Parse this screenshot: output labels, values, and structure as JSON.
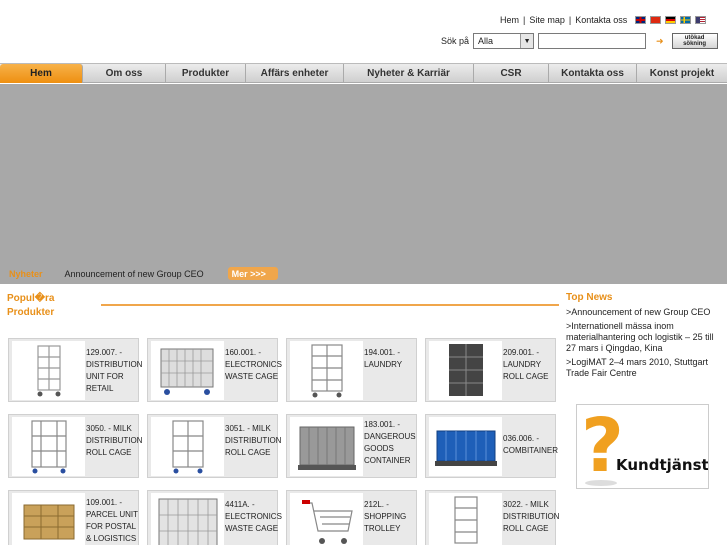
{
  "header": {
    "links": [
      "Hem",
      "Site map",
      "Kontakta oss"
    ],
    "link_separator": "|",
    "flags": [
      "uk-flag-icon",
      "china-flag-icon",
      "germany-flag-icon",
      "sweden-flag-icon",
      "usa-flag-icon"
    ]
  },
  "search": {
    "label": "Sök på",
    "scope_value": "Alla",
    "input_value": "",
    "advanced_label_line1": "utökad",
    "advanced_label_line2": "sökning"
  },
  "nav": {
    "items": [
      "Hem",
      "Om oss",
      "Produkter",
      "Affärs enheter",
      "Nyheter & Karriär",
      "CSR",
      "Kontakta oss",
      "Konst projekt"
    ],
    "active_index": 0
  },
  "ticker": {
    "label": "Nyheter",
    "text": "Announcement of new Group CEO",
    "more_label": "Mer  >>>"
  },
  "popular": {
    "title": "Popul�ra Produkter",
    "products": [
      {
        "code": "129.007. -",
        "name": "DISTRIBUTION UNIT FOR RETAIL",
        "icon": "roll-cage-icon"
      },
      {
        "code": "160.001. -",
        "name": "ELECTRONICS WASTE CAGE",
        "icon": "mesh-cage-icon"
      },
      {
        "code": "194.001. -",
        "name": "LAUNDRY",
        "icon": "roll-cage-icon"
      },
      {
        "code": "209.001. -",
        "name": "LAUNDRY ROLL CAGE",
        "icon": "dark-cage-icon"
      },
      {
        "code": "3050. - MILK",
        "name": "DISTRIBUTION ROLL CAGE",
        "icon": "milk-cage-icon"
      },
      {
        "code": "3051. - MILK",
        "name": "DISTRIBUTION ROLL CAGE",
        "icon": "milk-cage-icon"
      },
      {
        "code": "183.001. -",
        "name": "DANGEROUS GOODS CONTAINER",
        "icon": "container-icon"
      },
      {
        "code": "036.006. -",
        "name": "COMBITAINER",
        "icon": "blue-container-icon"
      },
      {
        "code": "109.001. -",
        "name": "PARCEL UNIT FOR POSTAL & LOGISTICS",
        "icon": "parcel-unit-icon"
      },
      {
        "code": "4411A. -",
        "name": "ELECTRONICS WASTE CAGE",
        "icon": "mesh-cage-icon"
      },
      {
        "code": "212L. -",
        "name": "SHOPPING TROLLEY",
        "icon": "trolley-icon"
      },
      {
        "code": "3022. - MILK",
        "name": "DISTRIBUTION ROLL CAGE",
        "icon": "roll-cage-icon"
      }
    ]
  },
  "topnews": {
    "title": "Top News",
    "items": [
      ">Announcement of new Group CEO",
      ">Internationell mässa inom materialhantering och logistik – 25 till 27 mars i Qingdao, Kina",
      ">LogiMAT 2–4 mars 2010, Stuttgart Trade Fair Centre"
    ]
  },
  "kundtjanst": {
    "label": "Kundtjänst"
  },
  "colors": {
    "accent": "#e8901a",
    "banner": "#a8a8a8",
    "card": "#e9e9e9"
  }
}
